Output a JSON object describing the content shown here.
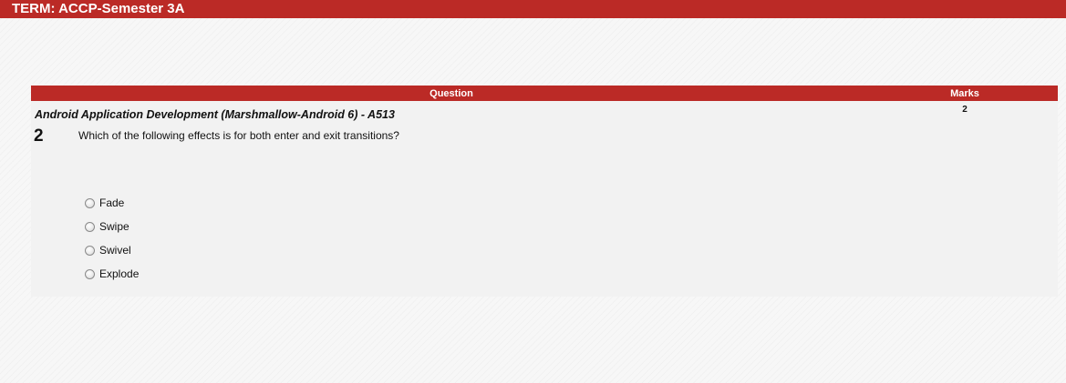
{
  "header": {
    "term_title": "TERM: ACCP-Semester 3A"
  },
  "table": {
    "col_question": "Question",
    "col_marks": "Marks"
  },
  "question": {
    "subject": "Android Application Development (Marshmallow-Android 6) - A513",
    "number": "2",
    "marks": "2",
    "text": "Which of the following effects is for both enter and exit transitions?",
    "options": [
      {
        "label": "Fade",
        "selected": false
      },
      {
        "label": "Swipe",
        "selected": false
      },
      {
        "label": "Swivel",
        "selected": false
      },
      {
        "label": "Explode",
        "selected": false
      }
    ]
  },
  "colors": {
    "accent": "#bb2a26",
    "panel_bg": "#f2f2f2",
    "page_bg": "#f7f7f7"
  }
}
